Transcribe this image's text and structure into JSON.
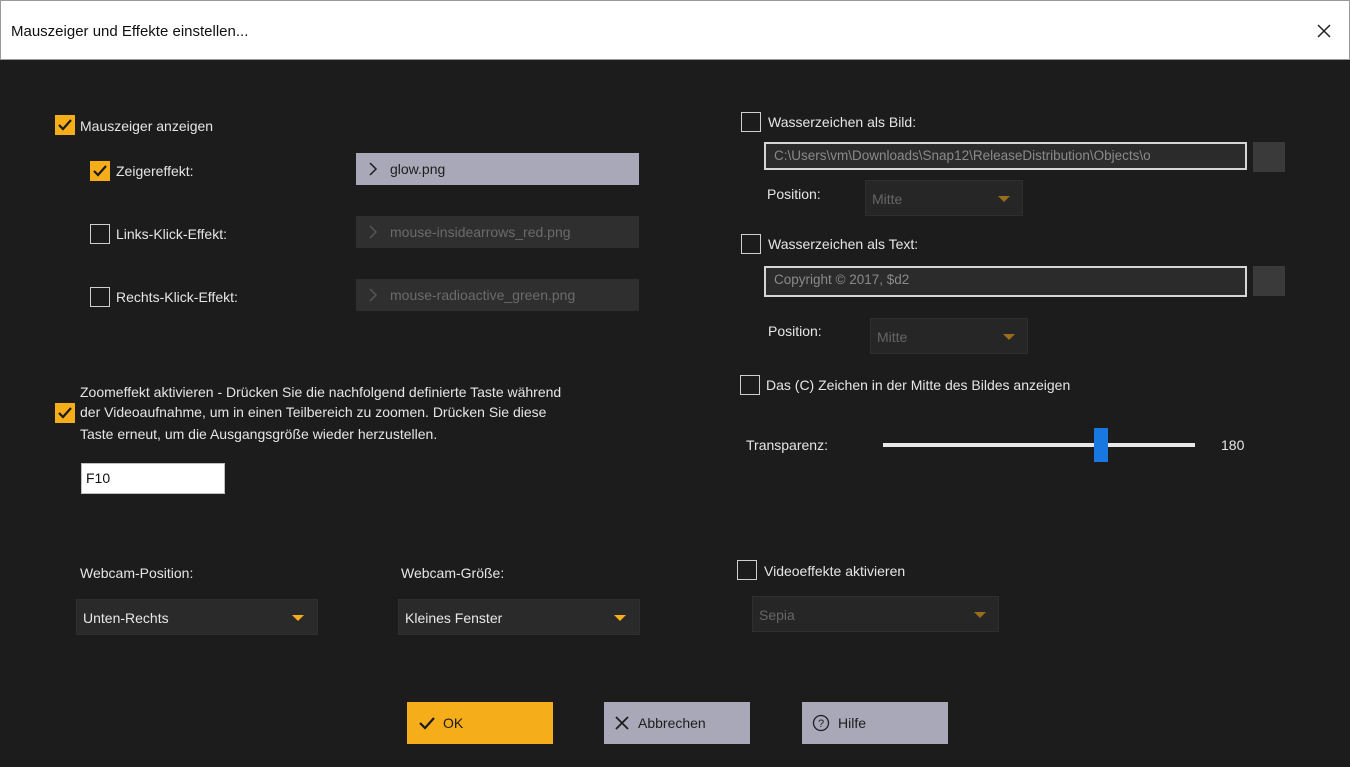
{
  "window": {
    "title": "Mauszeiger und Effekte einstellen..."
  },
  "cursor": {
    "show_label": "Mauszeiger anzeigen",
    "show_checked": true,
    "pointer_effect": {
      "label": "Zeigereffekt:",
      "checked": true,
      "file": "glow.png"
    },
    "left_click": {
      "label": "Links-Klick-Effekt:",
      "checked": false,
      "file": "mouse-insidearrows_red.png"
    },
    "right_click": {
      "label": "Rechts-Klick-Effekt:",
      "checked": false,
      "file": "mouse-radioactive_green.png"
    }
  },
  "zoom": {
    "checked": true,
    "line1": "Zoomeffekt aktivieren - Drücken Sie die nachfolgend definierte Taste während",
    "line2": "der Videoaufnahme, um in einen Teilbereich zu zoomen. Drücken Sie diese",
    "line3": "Taste erneut, um die Ausgangsgröße wieder herzustellen.",
    "key": "F10"
  },
  "webcam": {
    "position_label": "Webcam-Position:",
    "position_value": "Unten-Rechts",
    "size_label": "Webcam-Größe:",
    "size_value": "Kleines Fenster"
  },
  "watermark_image": {
    "label": "Wasserzeichen als Bild:",
    "checked": false,
    "path": "C:\\Users\\vm\\Downloads\\Snap12\\ReleaseDistribution\\Objects\\o",
    "position_label": "Position:",
    "position_value": "Mitte"
  },
  "watermark_text": {
    "label": "Wasserzeichen als Text:",
    "checked": false,
    "text": "Copyright © 2017, $d2",
    "position_label": "Position:",
    "position_value": "Mitte"
  },
  "copyright_center": {
    "label": "Das (C) Zeichen in der Mitte des Bildes anzeigen",
    "checked": false
  },
  "transparency": {
    "label": "Transparenz:",
    "value": "180",
    "fraction": 0.7
  },
  "video_effects": {
    "label": "Videoeffekte aktivieren",
    "checked": false,
    "value": "Sepia"
  },
  "buttons": {
    "ok": "OK",
    "cancel": "Abbrechen",
    "help": "Hilfe"
  },
  "colors": {
    "accent": "#f6ad1a",
    "slider_thumb": "#1877e0",
    "background": "#1c1c1c",
    "button_grey": "#a9a8b8"
  },
  "icons": {
    "close": "close-icon",
    "check": "checkmark-icon",
    "chevron": "chevron-right-icon",
    "help": "help-circle-icon",
    "cancel": "x-icon"
  }
}
